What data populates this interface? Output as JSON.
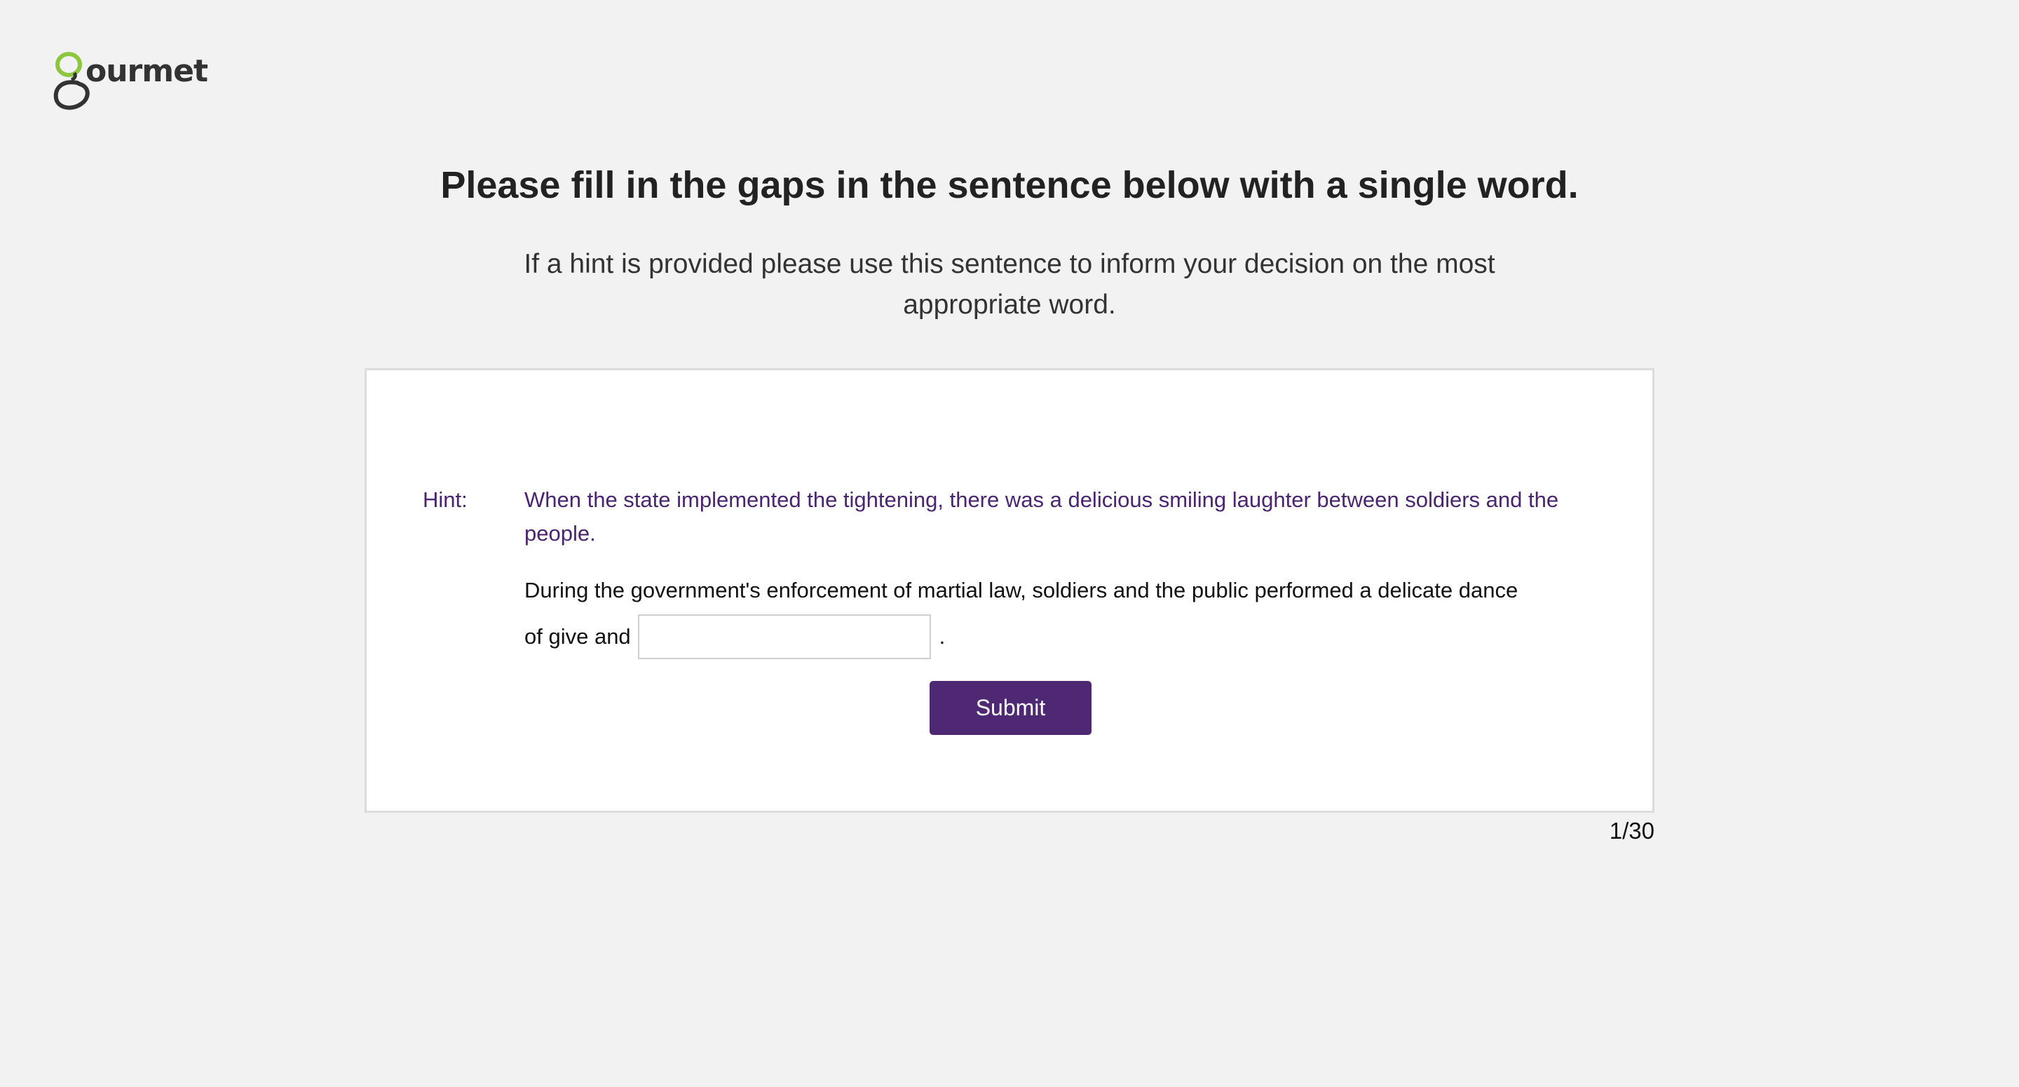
{
  "brand": {
    "logo_text": "ourmet",
    "logo_accent_color": "#8dc63f",
    "logo_dark_color": "#333333"
  },
  "header": {
    "title": "Please fill in the gaps in the sentence below with a single word.",
    "subtitle": "If a hint is provided please use this sentence to inform your decision on the most appropriate word."
  },
  "task": {
    "hint_label": "Hint:",
    "hint_text": "When the state implemented the tightening, there was a delicious smiling laughter between soldiers and the people.",
    "sentence_line1": "During the government's enforcement of martial law, soldiers and the public performed a delicate dance",
    "sentence_before_gap": "of give and",
    "sentence_after_gap": ".",
    "answer_value": "",
    "answer_placeholder": "",
    "submit_label": "Submit"
  },
  "progress": {
    "label": "1/30",
    "current": 1,
    "total": 30
  },
  "colors": {
    "background": "#f2f2f2",
    "accent": "#4e2872",
    "hint": "#4a2470"
  }
}
